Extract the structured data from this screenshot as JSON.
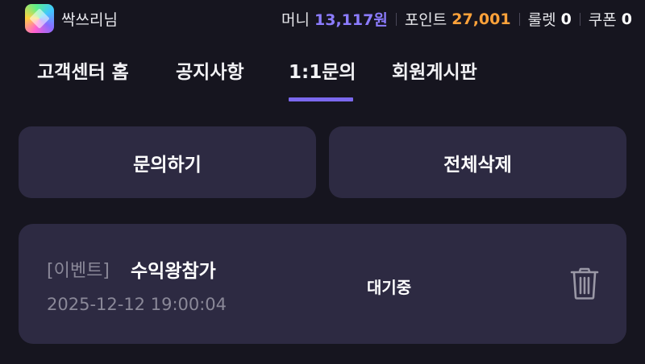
{
  "header": {
    "username": "싹쓰리님",
    "stats": [
      {
        "label": "머니",
        "value": "13,117원"
      },
      {
        "label": "포인트",
        "value": "27,001"
      },
      {
        "label": "룰렛",
        "value": "0"
      },
      {
        "label": "쿠폰",
        "value": "0"
      }
    ],
    "colors": {
      "money": "#8c7cff",
      "points": "#ffa23a"
    }
  },
  "tabs": [
    {
      "label": "고객센터 홈"
    },
    {
      "label": "공지사항"
    },
    {
      "label": "1:1문의",
      "active": true
    },
    {
      "label": "회원게시판"
    }
  ],
  "actions": {
    "inquire_label": "문의하기",
    "delete_all_label": "전체삭제"
  },
  "inquiries": [
    {
      "category": "[이벤트]",
      "title": "수익왕참가",
      "date": "2025-12-12 19:00:04",
      "status": "대기중",
      "icon": "trash-icon"
    }
  ],
  "theme": {
    "accent": "#7b68ee",
    "background": "#16151f",
    "card": "#2d2a42"
  }
}
